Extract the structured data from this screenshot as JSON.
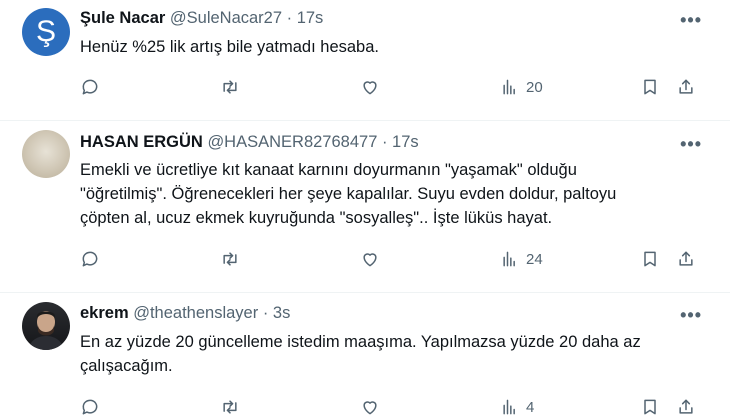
{
  "tweets": [
    {
      "avatar_letter": "Ş",
      "name": "Şule Nacar",
      "handle": "@SuleNacar27",
      "time": "· 17s",
      "more": "•••",
      "text": "Henüz %25 lik artış bile yatmadı hesaba.",
      "views": "20"
    },
    {
      "name": "HASAN ERGÜN",
      "handle": "@HASANER82768477",
      "time": "· 17s",
      "more": "•••",
      "text_lines": [
        "Emekli ve ücretliye kıt kanaat karnını doyurmanın \"yaşamak\" olduğu",
        "\"öğretilmiş\". Öğrenecekleri her şeye kapalılar. Suyu evden doldur, paltoyu",
        "çöpten al, ucuz ekmek kuyruğunda \"sosyalleş\".. İşte lüküs hayat."
      ],
      "views": "24"
    },
    {
      "name": "ekrem",
      "handle": "@theathenslayer",
      "time": "· 3s",
      "more": "•••",
      "text_lines": [
        "En az yüzde 20 güncelleme istedim maaşıma. Yapılmazsa yüzde 20 daha az",
        "çalışacağım."
      ],
      "views": "4"
    }
  ]
}
